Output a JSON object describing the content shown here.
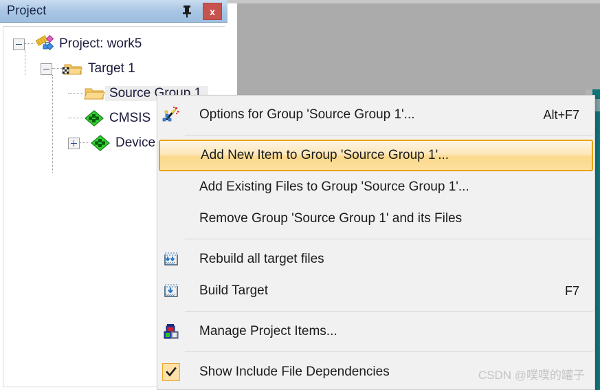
{
  "panel": {
    "title": "Project",
    "pin_icon": "pin-icon",
    "close_label": "x",
    "tree": [
      {
        "id": "project-root",
        "label": "Project: work5",
        "icon": "project-icon",
        "expander": "minus",
        "depth": 0
      },
      {
        "id": "target-1",
        "label": "Target 1",
        "icon": "target-folder-icon",
        "expander": "minus",
        "depth": 1
      },
      {
        "id": "source-group-1",
        "label": "Source Group 1",
        "icon": "folder-icon",
        "expander": "none",
        "depth": 2,
        "selected": true
      },
      {
        "id": "cmsis",
        "label": "CMSIS",
        "icon": "green-diamond-icon",
        "expander": "none",
        "depth": 2
      },
      {
        "id": "device",
        "label": "Device",
        "icon": "green-diamond-icon",
        "expander": "plus",
        "depth": 2
      }
    ]
  },
  "context_menu": {
    "items": [
      {
        "id": "options-for-group",
        "label": "Options for Group 'Source Group 1'...",
        "accel": "Alt+F7",
        "icon": "magic-wand-icon",
        "highlighted": false,
        "checked": false
      },
      {
        "id": "add-new-item",
        "label": "Add New  Item to Group 'Source Group 1'...",
        "accel": "",
        "icon": "none",
        "highlighted": true,
        "checked": false
      },
      {
        "id": "add-existing-files",
        "label": "Add Existing Files to Group 'Source Group 1'...",
        "accel": "",
        "icon": "none",
        "highlighted": false,
        "checked": false
      },
      {
        "id": "remove-group",
        "label": "Remove Group 'Source Group 1' and its Files",
        "accel": "",
        "icon": "none",
        "highlighted": false,
        "checked": false
      },
      {
        "id": "rebuild-all-target-files",
        "label": "Rebuild all target files",
        "accel": "",
        "icon": "rebuild-icon",
        "highlighted": false,
        "checked": false
      },
      {
        "id": "build-target",
        "label": "Build Target",
        "accel": "F7",
        "icon": "build-icon",
        "highlighted": false,
        "checked": false
      },
      {
        "id": "manage-project-items",
        "label": "Manage Project Items...",
        "accel": "",
        "icon": "blocks-icon",
        "highlighted": false,
        "checked": false
      },
      {
        "id": "show-include-file-dependencies",
        "label": "Show Include File Dependencies",
        "accel": "",
        "icon": "checkmark-icon",
        "highlighted": false,
        "checked": true
      }
    ]
  },
  "watermark": {
    "text": "CSDN @噗噗的罐子"
  },
  "colors": {
    "titlebar_gradient_top": "#c9dcf0",
    "titlebar_gradient_bottom": "#9dbedf",
    "close_button": "#c7534f",
    "menu_background": "#f1f1f1",
    "highlight_border": "#e8a400",
    "highlight_fill": "#fcd98b",
    "editor_background": "#ababab",
    "teal_strip": "#0e7279"
  }
}
